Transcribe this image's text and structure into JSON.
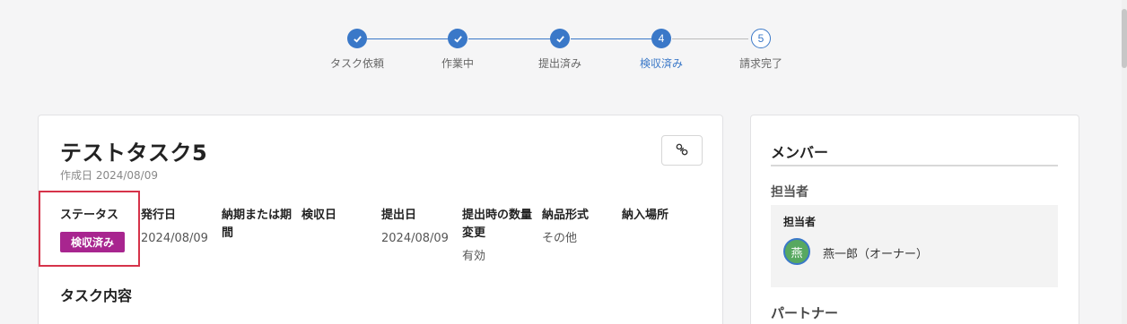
{
  "stepper": {
    "steps": [
      {
        "label": "タスク依頼",
        "state": "done",
        "mark": "check"
      },
      {
        "label": "作業中",
        "state": "done",
        "mark": "check"
      },
      {
        "label": "提出済み",
        "state": "done",
        "mark": "check"
      },
      {
        "label": "検収済み",
        "state": "current",
        "mark": "4"
      },
      {
        "label": "請求完了",
        "state": "todo",
        "mark": "5"
      }
    ]
  },
  "task": {
    "title": "テストタスク5",
    "created": "作成日 2024/08/09",
    "link_icon": "link-icon",
    "fields": {
      "status": {
        "label": "ステータス",
        "value": "検収済み"
      },
      "issue_date": {
        "label": "発行日",
        "value": "2024/08/09"
      },
      "deadline": {
        "label": "納期または期間",
        "value": ""
      },
      "accept_date": {
        "label": "検収日",
        "value": ""
      },
      "submit_date": {
        "label": "提出日",
        "value": "2024/08/09"
      },
      "qty_change": {
        "label": "提出時の数量変更",
        "value": "有効"
      },
      "format": {
        "label": "納品形式",
        "value": "その他"
      },
      "place": {
        "label": "納入場所",
        "value": ""
      }
    },
    "section_title": "タスク内容"
  },
  "members": {
    "title": "メンバー",
    "assignee_heading": "担当者",
    "assignee_box_label": "担当者",
    "assignee_avatar": "燕",
    "assignee_name": "燕一郎（オーナー）",
    "partner_heading": "パートナー"
  },
  "colors": {
    "accent": "#3a78c8",
    "badge": "#a8258f",
    "highlight": "#d6334a"
  }
}
